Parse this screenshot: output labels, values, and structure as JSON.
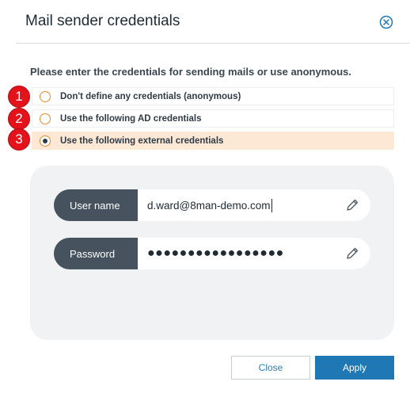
{
  "dialog": {
    "title": "Mail sender credentials",
    "instruction": "Please enter the credentials for sending mails or use anonymous."
  },
  "options": [
    {
      "badge": "1",
      "label": "Don't define any credentials (anonymous)",
      "selected": false
    },
    {
      "badge": "2",
      "label": "Use the following AD credentials",
      "selected": false
    },
    {
      "badge": "3",
      "label": "Use the following external credentials",
      "selected": true
    }
  ],
  "credentials": {
    "username_label": "User name",
    "username_value": "d.ward@8man-demo.com",
    "password_label": "Password",
    "password_value": "●●●●●●●●●●●●●●●●●"
  },
  "footer": {
    "close_label": "Close",
    "apply_label": "Apply"
  },
  "colors": {
    "accent_orange": "#e78a2c",
    "selected_row": "#fde8d6",
    "label_dark": "#46535e",
    "apply_blue": "#1f78b4",
    "badge_red": "#e3121b"
  },
  "icons": {
    "close": "close-circle-icon",
    "edit": "pencil-icon"
  }
}
